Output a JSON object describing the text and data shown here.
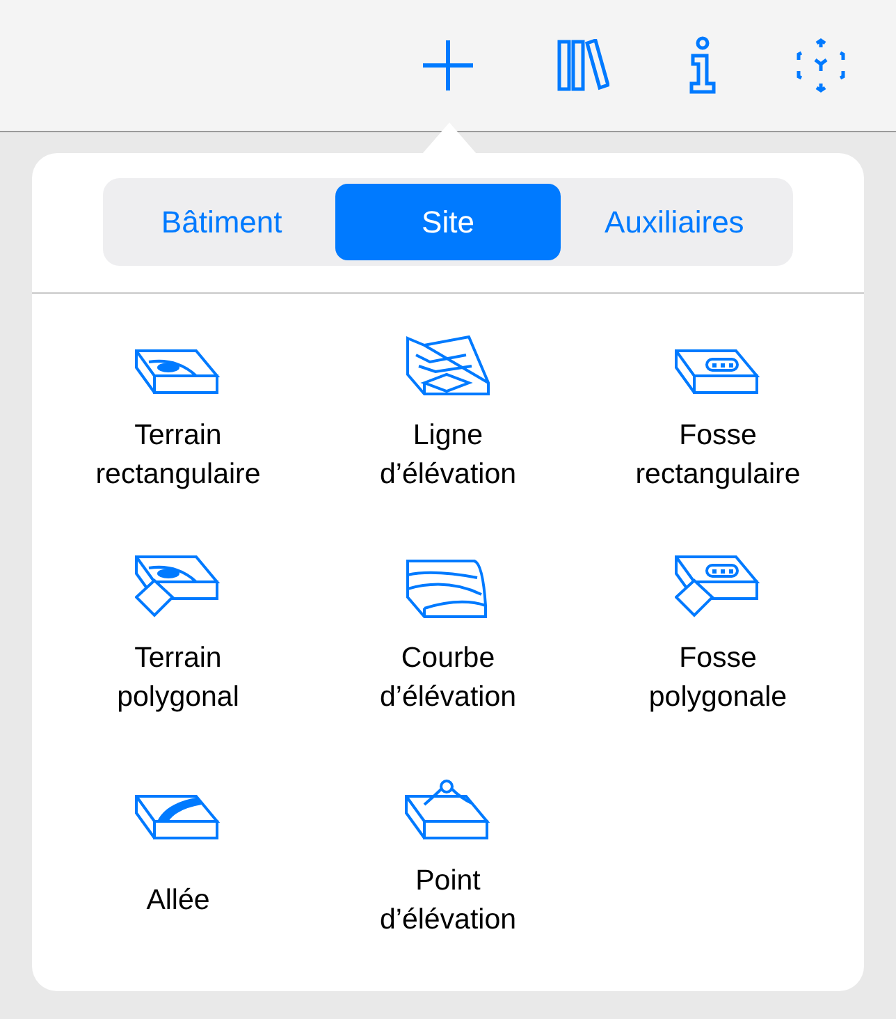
{
  "segments": [
    {
      "label": "Bâtiment",
      "selected": false
    },
    {
      "label": "Site",
      "selected": true
    },
    {
      "label": "Auxiliaires",
      "selected": false
    }
  ],
  "tools": [
    {
      "label": "Terrain\nrectangulaire"
    },
    {
      "label": "Ligne\nd’élévation"
    },
    {
      "label": "Fosse\nrectangulaire"
    },
    {
      "label": "Terrain\npolygonal"
    },
    {
      "label": "Courbe\nd’élévation"
    },
    {
      "label": "Fosse\npolygonale"
    },
    {
      "label": "Allée"
    },
    {
      "label": "Point\nd’élévation"
    }
  ]
}
